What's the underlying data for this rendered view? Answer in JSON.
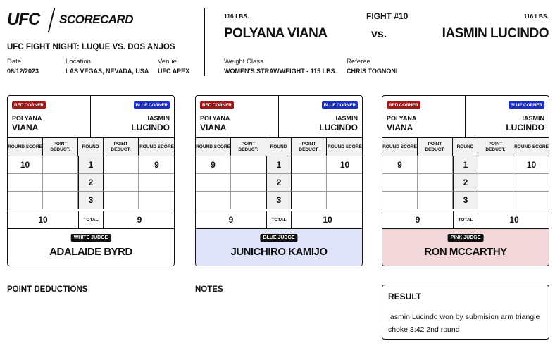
{
  "header": {
    "logo": "UFC",
    "scorecard_word": "SCORECARD",
    "event_title": "UFC FIGHT NIGHT: LUQUE VS. DOS ANJOS",
    "date_label": "Date",
    "date": "08/12/2023",
    "location_label": "Location",
    "location": "LAS VEGAS, NEVADA, USA",
    "venue_label": "Venue",
    "venue": "UFC APEX"
  },
  "fight": {
    "number": "FIGHT #10",
    "red_weight": "116 LBS.",
    "blue_weight": "116 LBS.",
    "red_name": "POLYANA VIANA",
    "blue_name": "IASMIN LUCINDO",
    "vs": "vs.",
    "weight_class_label": "Weight Class",
    "weight_class": "WOMEN'S STRAWWEIGHT - 115 LBS.",
    "referee_label": "Referee",
    "referee": "CHRIS TOGNONI"
  },
  "labels": {
    "red_corner": "RED CORNER",
    "blue_corner": "BLUE CORNER",
    "red_first": "POLYANA",
    "red_last": "VIANA",
    "blue_first": "IASMIN",
    "blue_last": "LUCINDO",
    "round_score": "ROUND SCORE",
    "point_deduct": "POINT DEDUCT.",
    "round": "ROUND",
    "total": "TOTAL",
    "rounds": [
      "1",
      "2",
      "3"
    ]
  },
  "cards": [
    {
      "judge_badge": "WHITE JUDGE",
      "judge_name": "ADALAIDE BYRD",
      "bg": "#ffffff",
      "red_scores": [
        "10",
        "",
        ""
      ],
      "red_deduct": [
        "",
        "",
        ""
      ],
      "blue_deduct": [
        "",
        "",
        ""
      ],
      "blue_scores": [
        "9",
        "",
        ""
      ],
      "red_total": "10",
      "blue_total": "9"
    },
    {
      "judge_badge": "BLUE JUDGE",
      "judge_name": "JUNICHIRO KAMIJO",
      "bg": "#dfe4fb",
      "red_scores": [
        "9",
        "",
        ""
      ],
      "red_deduct": [
        "",
        "",
        ""
      ],
      "blue_deduct": [
        "",
        "",
        ""
      ],
      "blue_scores": [
        "10",
        "",
        ""
      ],
      "red_total": "9",
      "blue_total": "10"
    },
    {
      "judge_badge": "PINK JUDGE",
      "judge_name": "RON MCCARTHY",
      "bg": "#f1d7d9",
      "red_scores": [
        "9",
        "",
        ""
      ],
      "red_deduct": [
        "",
        "",
        ""
      ],
      "blue_deduct": [
        "",
        "",
        ""
      ],
      "blue_scores": [
        "10",
        "",
        ""
      ],
      "red_total": "9",
      "blue_total": "10"
    }
  ],
  "footer": {
    "point_deductions": "POINT DEDUCTIONS",
    "notes": "NOTES",
    "result_title": "RESULT",
    "result_text": "Iasmin Lucindo won by submision arm triangle choke 3:42 2nd round"
  }
}
